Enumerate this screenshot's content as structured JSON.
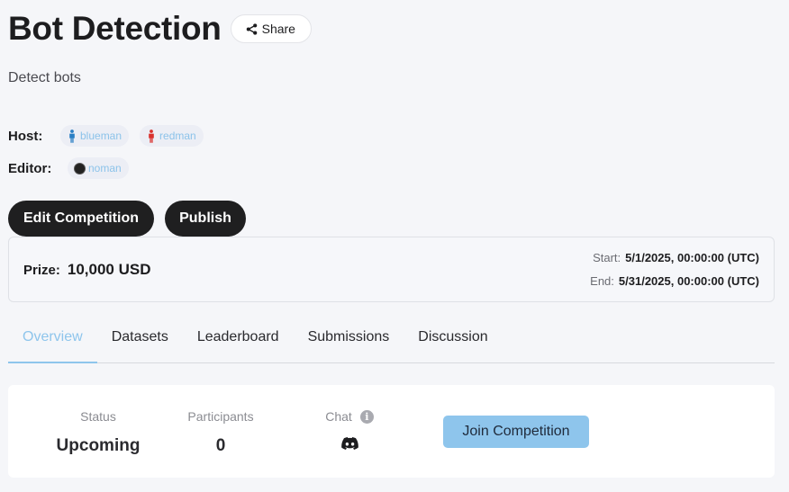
{
  "header": {
    "title": "Bot Detection",
    "share_label": "Share",
    "subtitle": "Detect bots"
  },
  "people": {
    "host_label": "Host:",
    "hosts": [
      {
        "name": "blueman",
        "icon": "person-icon",
        "color": "#2a7fc4"
      },
      {
        "name": "redman",
        "icon": "person-icon",
        "color": "#d9302c"
      }
    ],
    "editor_label": "Editor:",
    "editors": [
      {
        "name": "noman",
        "icon": "avatar-icon"
      }
    ]
  },
  "actions": {
    "edit_label": "Edit Competition",
    "publish_label": "Publish"
  },
  "prize": {
    "label": "Prize:",
    "value": "10,000 USD",
    "start_label": "Start:",
    "start_value": "5/1/2025, 00:00:00 (UTC)",
    "end_label": "End:",
    "end_value": "5/31/2025, 00:00:00 (UTC)"
  },
  "tabs": [
    {
      "label": "Overview",
      "active": true
    },
    {
      "label": "Datasets",
      "active": false
    },
    {
      "label": "Leaderboard",
      "active": false
    },
    {
      "label": "Submissions",
      "active": false
    },
    {
      "label": "Discussion",
      "active": false
    }
  ],
  "stats": {
    "status_label": "Status",
    "status_value": "Upcoming",
    "participants_label": "Participants",
    "participants_value": "0",
    "chat_label": "Chat",
    "chat_icon": "discord-icon",
    "info_icon": "info-icon"
  },
  "join_label": "Join Competition",
  "colors": {
    "accent": "#8ec5ec",
    "dark_button": "#1f1f20",
    "background": "#f5f6f9"
  }
}
